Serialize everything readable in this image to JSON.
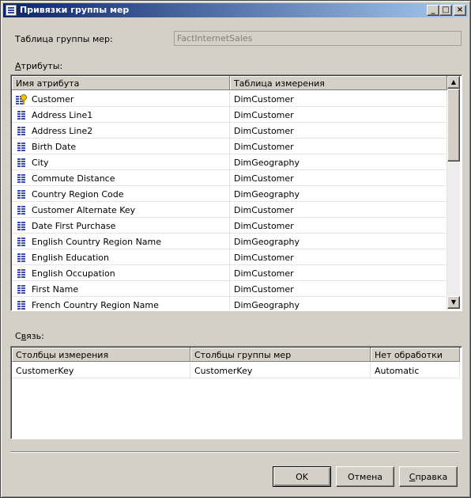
{
  "window": {
    "title": "Привязки группы мер",
    "controls": {
      "minimize": "_",
      "maximize": "□",
      "close": "×"
    }
  },
  "measure_group": {
    "label": "Таблица группы мер:",
    "value": "FactInternetSales"
  },
  "attributes": {
    "label_accel": "А",
    "label_rest": "трибуты:",
    "columns": [
      "Имя атрибута",
      "Таблица измерения"
    ],
    "rows": [
      {
        "name": "Customer",
        "table": "DimCustomer",
        "icon": "key-attribute-icon"
      },
      {
        "name": "Address Line1",
        "table": "DimCustomer",
        "icon": "attribute-icon"
      },
      {
        "name": "Address Line2",
        "table": "DimCustomer",
        "icon": "attribute-icon"
      },
      {
        "name": "Birth Date",
        "table": "DimCustomer",
        "icon": "attribute-icon"
      },
      {
        "name": "City",
        "table": "DimGeography",
        "icon": "attribute-icon"
      },
      {
        "name": "Commute Distance",
        "table": "DimCustomer",
        "icon": "attribute-icon"
      },
      {
        "name": "Country Region Code",
        "table": "DimGeography",
        "icon": "attribute-icon"
      },
      {
        "name": "Customer Alternate Key",
        "table": "DimCustomer",
        "icon": "attribute-icon"
      },
      {
        "name": "Date First Purchase",
        "table": "DimCustomer",
        "icon": "attribute-icon"
      },
      {
        "name": "English Country Region Name",
        "table": "DimGeography",
        "icon": "attribute-icon"
      },
      {
        "name": "English Education",
        "table": "DimCustomer",
        "icon": "attribute-icon"
      },
      {
        "name": "English Occupation",
        "table": "DimCustomer",
        "icon": "attribute-icon"
      },
      {
        "name": "First Name",
        "table": "DimCustomer",
        "icon": "attribute-icon"
      },
      {
        "name": "French Country Region Name",
        "table": "DimGeography",
        "icon": "attribute-icon"
      }
    ]
  },
  "relationship": {
    "label_pre": "С",
    "label_accel": "в",
    "label_post": "язь:",
    "columns": [
      "Столбцы измерения",
      "Столбцы группы мер",
      "Нет обработки"
    ],
    "rows": [
      {
        "dimension_column": "CustomerKey",
        "measure_group_column": "CustomerKey",
        "null_processing": "Automatic"
      }
    ]
  },
  "buttons": {
    "ok": "OK",
    "cancel": "Отмена",
    "help_accel": "С",
    "help_rest": "правка"
  },
  "colors": {
    "title_gradient_start": "#0a246a",
    "title_gradient_end": "#a6caf0",
    "dialog_face": "#d4d0c8"
  }
}
